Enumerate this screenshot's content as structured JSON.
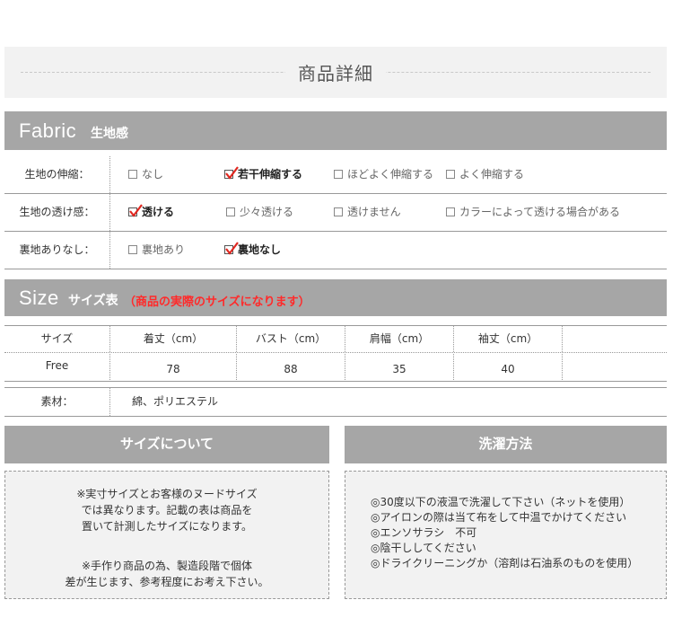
{
  "page_title": "商品詳細",
  "fabric": {
    "heading_en": "Fabric",
    "heading_jp": "生地感",
    "rows": [
      {
        "label": "生地の伸縮：",
        "options": [
          {
            "text": "なし",
            "checked": false
          },
          {
            "text": "若干伸縮する",
            "checked": true
          },
          {
            "text": "ほどよく伸縮する",
            "checked": false
          },
          {
            "text": "よく伸縮する",
            "checked": false
          }
        ]
      },
      {
        "label": "生地の透け感：",
        "options": [
          {
            "text": "透ける",
            "checked": true
          },
          {
            "text": "少々透ける",
            "checked": false
          },
          {
            "text": "透けません",
            "checked": false
          },
          {
            "text": "カラーによって透ける場合がある",
            "checked": false
          }
        ]
      },
      {
        "label": "裏地ありなし：",
        "options": [
          {
            "text": "裏地あり",
            "checked": false
          },
          {
            "text": "裏地なし",
            "checked": true
          }
        ]
      }
    ]
  },
  "size": {
    "heading_en": "Size",
    "heading_jp": "サイズ表",
    "note": "（商品の実際のサイズになります）",
    "headers": [
      "サイズ",
      "着丈（cm）",
      "バスト（cm）",
      "肩幅（cm）",
      "袖丈（cm）",
      ""
    ],
    "rows": [
      [
        "Free",
        "78",
        "88",
        "35",
        "40",
        ""
      ]
    ]
  },
  "material": {
    "label": "素材：",
    "value": "綿、ポリエステル"
  },
  "about_size": {
    "heading": "サイズについて",
    "paragraph1": [
      "※実寸サイズとお客様のヌードサイズ",
      "では異なります。記載の表は商品を",
      "置いて計測したサイズになります。"
    ],
    "paragraph2": [
      "※手作り商品の為、製造段階で個体",
      "差が生じます、参考程度にお考え下さい。"
    ]
  },
  "washing": {
    "heading": "洗濯方法",
    "items": [
      "◎30度以下の液温で洗濯して下さい（ネットを使用）",
      "◎アイロンの際は当て布をして中温でかけてください",
      "◎エンソサラシ　不可",
      "◎陰干ししてください",
      "◎ドライクリーニングか（溶剤は石油系のものを使用）"
    ]
  },
  "colors": {
    "section_gray": "#a6a6a6",
    "check_red": "#e0261f",
    "note_red": "#ff2a2a",
    "box_bg": "#f2f2f2"
  }
}
